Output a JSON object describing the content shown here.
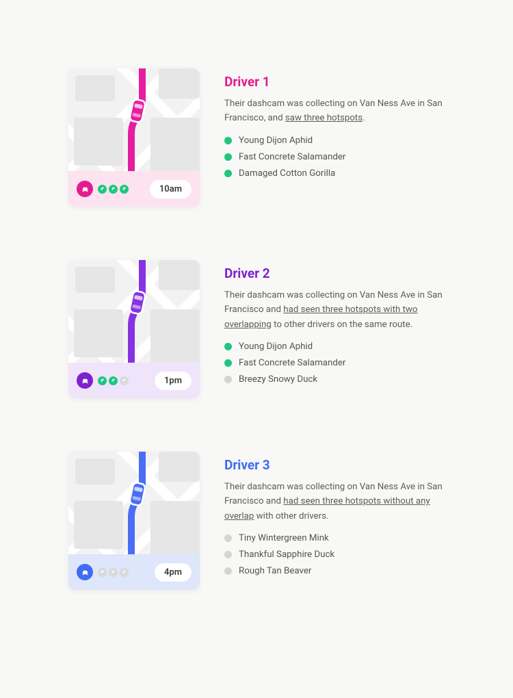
{
  "drivers": [
    {
      "title": "Driver 1",
      "desc_pre": "Their dashcam was collecting on Van Ness Ave in San Francisco, and ",
      "desc_u": "saw three hotspots",
      "desc_post": ".",
      "time": "10am",
      "pips": [
        "on",
        "on",
        "on"
      ],
      "hotspots": [
        {
          "name": "Young Dijon Aphid",
          "state": "on"
        },
        {
          "name": "Fast Concrete Salamander",
          "state": "on"
        },
        {
          "name": "Damaged Cotton Gorilla",
          "state": "on"
        }
      ]
    },
    {
      "title": "Driver 2",
      "desc_pre": "Their dashcam was collecting on Van Ness Ave in San Francisco and ",
      "desc_u": "had seen three hotspots with two overlapping",
      "desc_post": " to other drivers on the same route.",
      "time": "1pm",
      "pips": [
        "on",
        "on",
        "off"
      ],
      "hotspots": [
        {
          "name": "Young Dijon Aphid",
          "state": "on"
        },
        {
          "name": "Fast Concrete Salamander",
          "state": "on"
        },
        {
          "name": "Breezy Snowy Duck",
          "state": "off"
        }
      ]
    },
    {
      "title": "Driver 3",
      "desc_pre": "Their dashcam was collecting on Van Ness Ave in San Francisco and ",
      "desc_u": "had seen three hotspots without any overlap",
      "desc_post": " with other drivers.",
      "time": "4pm",
      "pips": [
        "off",
        "off",
        "off"
      ],
      "hotspots": [
        {
          "name": "Tiny Wintergreen Mink",
          "state": "off"
        },
        {
          "name": "Thankful Sapphire Duck",
          "state": "off"
        },
        {
          "name": "Rough Tan Beaver",
          "state": "off"
        }
      ]
    }
  ]
}
